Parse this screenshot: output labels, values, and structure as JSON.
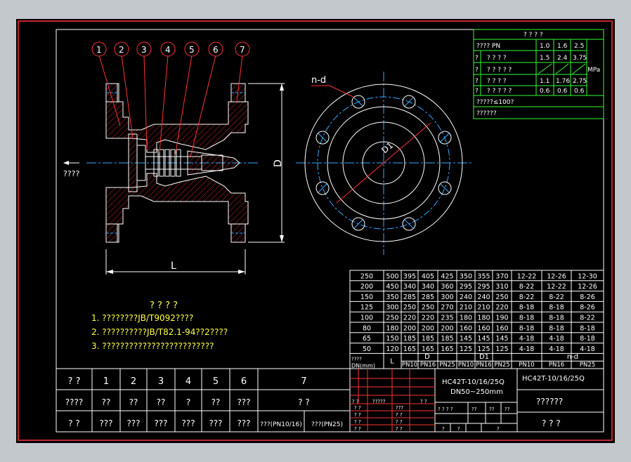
{
  "parts": {
    "balloons": [
      "1",
      "2",
      "3",
      "4",
      "5",
      "6",
      "7"
    ],
    "flow_label": "????",
    "dim_L": "L",
    "dim_D": "D",
    "dim_D1": "D1",
    "dim_nd": "n-d"
  },
  "notes": {
    "title": "? ? ? ?",
    "lines": [
      "1. ????????JB/T9092????",
      "2. ??????????JB/T82.1-94??2????",
      "3. ?????????????????????????"
    ]
  },
  "spec_table": {
    "title": "? ? ? ?",
    "header": {
      "label": "???? PN",
      "cols": [
        "1.0",
        "1.6",
        "2.5"
      ]
    },
    "rows": [
      {
        "q": "?",
        "label": "? ? ? ?",
        "vals": [
          "1.5",
          "2.4",
          "3.75"
        ],
        "unit": ""
      },
      {
        "q": "?",
        "label": "? ? ? ? ?",
        "vals": [
          "",
          "",
          ""
        ],
        "unit": "MPa"
      },
      {
        "q": "?",
        "label": "? ? ? ?",
        "vals": [
          "1.1",
          "1.76",
          "2.75"
        ],
        "unit": ""
      },
      {
        "q": "?",
        "label": "? ? ? ? ?",
        "vals": [
          "0.6",
          "0.6",
          "0.6"
        ],
        "unit": ""
      }
    ],
    "temp": "?????≤100?",
    "medium": "??????"
  },
  "dim_table": {
    "rows": [
      [
        "250",
        "500",
        "395",
        "405",
        "425",
        "350",
        "355",
        "370",
        "12-22",
        "12-26",
        "12-30"
      ],
      [
        "200",
        "450",
        "340",
        "340",
        "360",
        "295",
        "295",
        "310",
        "8-22",
        "12-22",
        "12-26"
      ],
      [
        "150",
        "350",
        "285",
        "285",
        "300",
        "240",
        "240",
        "250",
        "8-22",
        "8-22",
        "8-26"
      ],
      [
        "125",
        "300",
        "250",
        "250",
        "270",
        "210",
        "210",
        "220",
        "8-18",
        "8-18",
        "8-26"
      ],
      [
        "100",
        "250",
        "220",
        "220",
        "235",
        "180",
        "180",
        "190",
        "8-18",
        "8-18",
        "8-22"
      ],
      [
        "80",
        "180",
        "200",
        "200",
        "200",
        "160",
        "160",
        "160",
        "8-18",
        "8-18",
        "8-18"
      ],
      [
        "65",
        "150",
        "185",
        "185",
        "185",
        "145",
        "145",
        "145",
        "4-18",
        "4-18",
        "8-18"
      ],
      [
        "50",
        "120",
        "165",
        "165",
        "165",
        "125",
        "125",
        "125",
        "4-18",
        "4-18",
        "4-18"
      ]
    ],
    "head_dn": "????\nDN(mm)",
    "head_L": "L",
    "head_D": "D",
    "head_D1": "D1",
    "head_nd": "n-d",
    "pn": [
      "PN10",
      "PN16",
      "PN25",
      "PN10",
      "PN16",
      "PN25",
      "PN10",
      "PN16",
      "PN25"
    ]
  },
  "parts_table": {
    "row1": [
      "? ?",
      "1",
      "2",
      "3",
      "4",
      "5",
      "6",
      "7"
    ],
    "row2": [
      "????",
      "??",
      "??",
      "??",
      "?",
      "??",
      "???",
      "? ?"
    ],
    "row3": [
      "? ?",
      "???",
      "???",
      "???",
      "???",
      "???",
      "???",
      "???(PN10/16)",
      "???(PN25)"
    ]
  },
  "title_block": {
    "model": "HC42T-10/16/25Q",
    "range": "DN50~250mm",
    "model_right": "HC42T-10/16/25Q",
    "name": "??????",
    "company": "? ? ?",
    "small": {
      "c1": "? ?",
      "c2": "?????",
      "c3": "? ?",
      "r1": "? ?",
      "r2": "? ?",
      "r3": "? ?",
      "r4": "? ?",
      "m1": "???",
      "m2": "? ?",
      "m3": "? ?",
      "m4": "? ?",
      "s1": "? ? ? ?",
      "s2": "??",
      "s3": "??",
      "s4": "??",
      "t1": "?",
      "t2": "?",
      "t3": "?"
    }
  }
}
